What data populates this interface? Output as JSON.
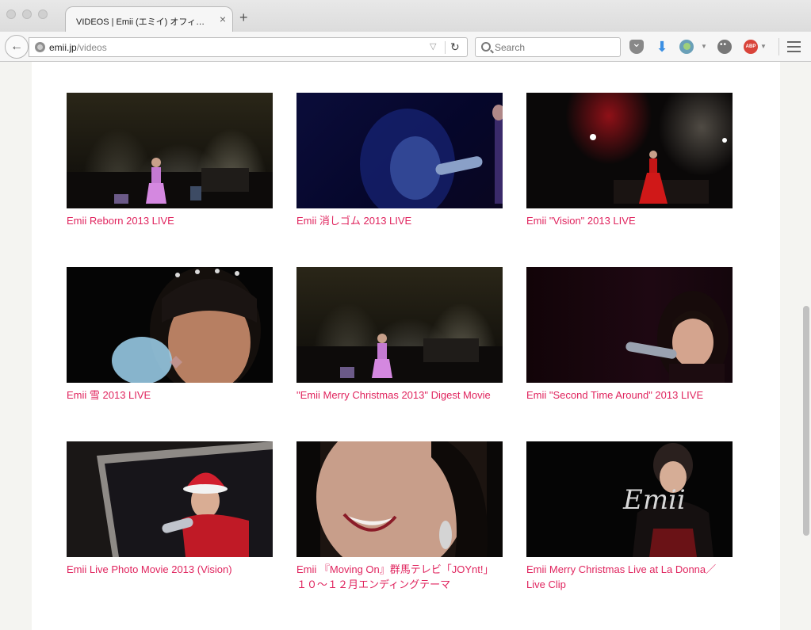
{
  "browser": {
    "tab_title": "VIDEOS | Emii (エミイ) オフィシャ…",
    "tab_close": "×",
    "new_tab": "+",
    "url_host": "emii.jp",
    "url_path": "/videos",
    "search_placeholder": "Search",
    "back_icon": "←",
    "reload_icon": "↻",
    "url_dropdown": "▽",
    "download_icon": "⬇",
    "abp_label": "ABP"
  },
  "videos": [
    {
      "title": "Emii Reborn 2013 LIVE",
      "thumb": "stage-pink"
    },
    {
      "title": "Emii 消しゴム 2013 LIVE",
      "thumb": "blue-closeup"
    },
    {
      "title": "Emii \"Vision\" 2013 LIVE",
      "thumb": "stage-red"
    },
    {
      "title": "Emii 雪 2013 LIVE",
      "thumb": "closeup-crown"
    },
    {
      "title": "\"Emii Merry Christmas 2013\" Digest Movie",
      "thumb": "stage-pink"
    },
    {
      "title": "Emii \"Second Time Around\" 2013 LIVE",
      "thumb": "singer-mic"
    },
    {
      "title": "Emii Live Photo Movie 2013 (Vision)",
      "thumb": "santa-photo"
    },
    {
      "title": "Emii 『Moving On』群馬テレビ「JOYnt!」１０〜１２月エンディングテーマ",
      "thumb": "smile-closeup"
    },
    {
      "title": "Emii Merry Christmas Live at La Donna／Live Clip",
      "thumb": "emii-logo",
      "thumb_text": "Emii"
    }
  ]
}
